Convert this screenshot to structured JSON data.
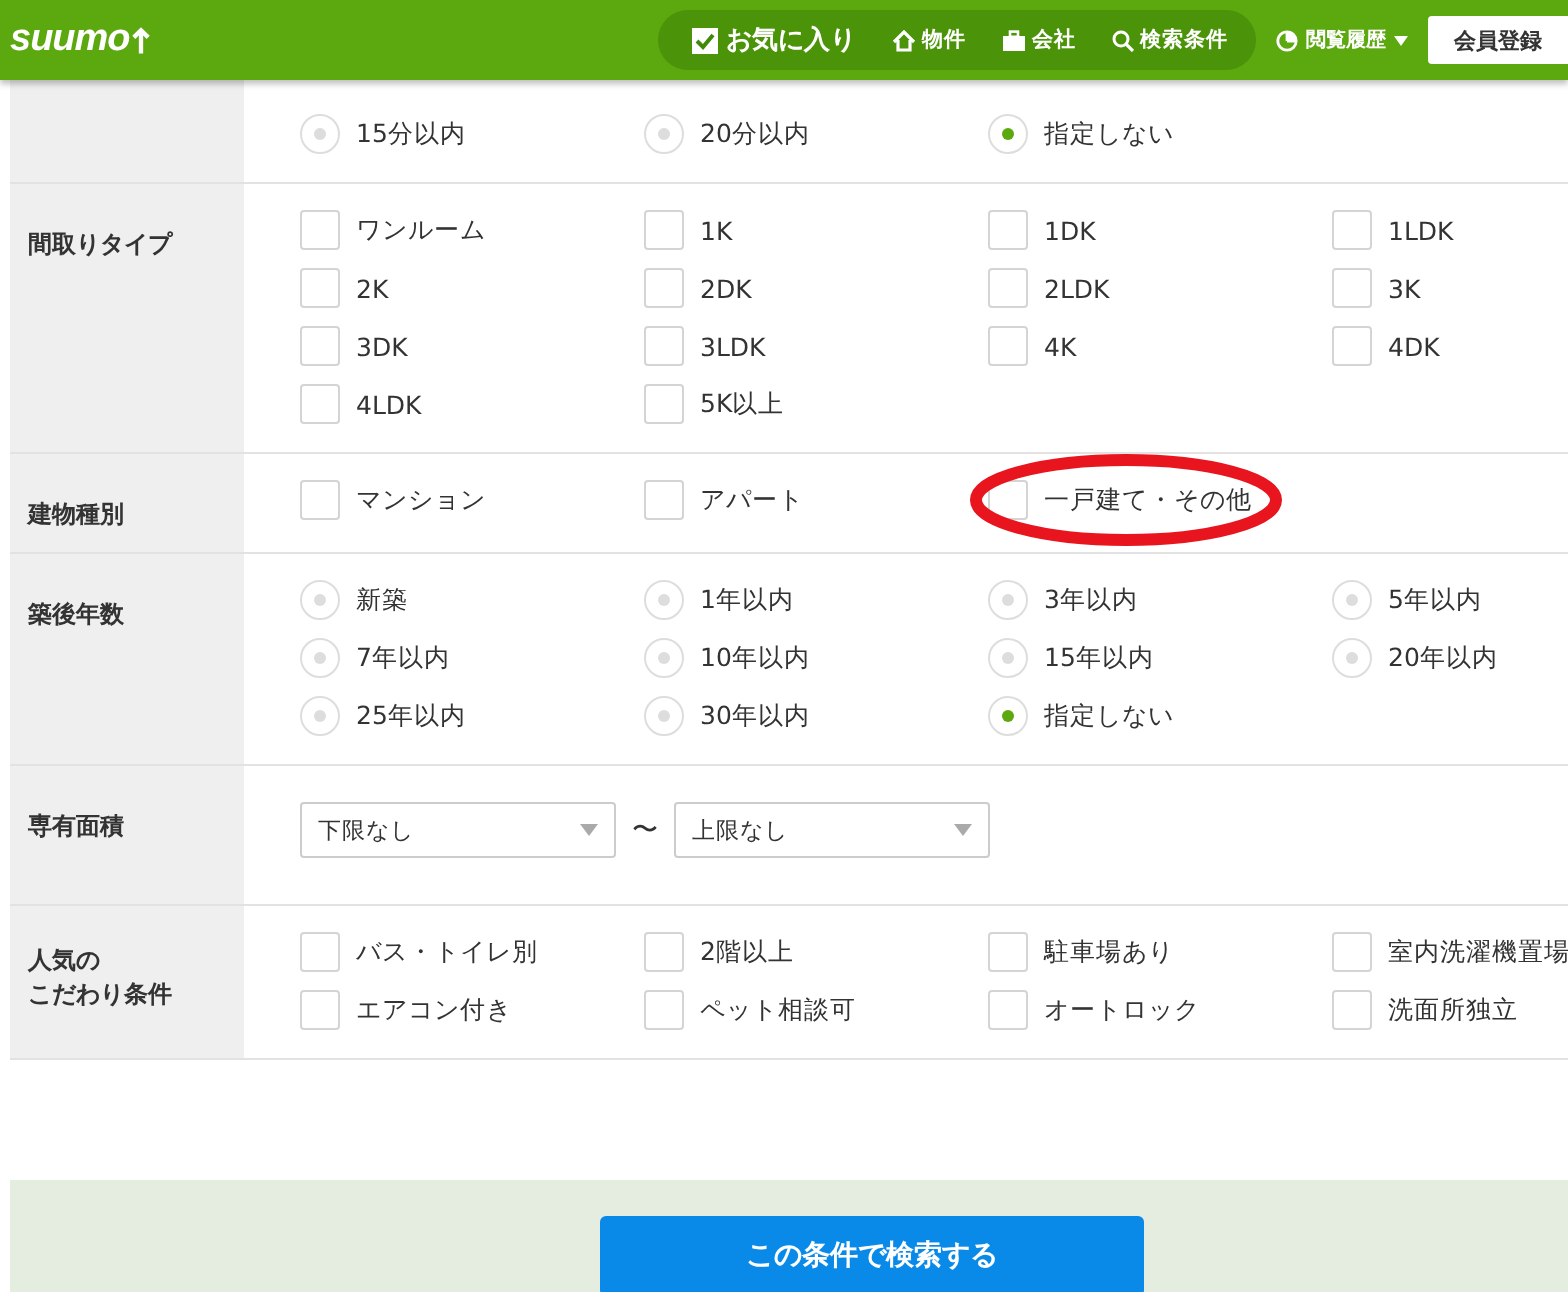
{
  "header": {
    "logo": "suumo",
    "nav": [
      {
        "kind": "favorite",
        "label": "お気に入り"
      },
      {
        "kind": "home",
        "label": "物件"
      },
      {
        "kind": "company",
        "label": "会社"
      },
      {
        "kind": "search",
        "label": "検索条件"
      }
    ],
    "history": "閲覧履歴",
    "register": "会員登録"
  },
  "sections": [
    {
      "kind": "radio",
      "options": [
        {
          "label": "15分以内",
          "selected": false
        },
        {
          "label": "20分以内",
          "selected": false
        },
        {
          "label": "指定しない",
          "selected": true
        }
      ]
    },
    {
      "label": "間取りタイプ",
      "kind": "checkbox",
      "options": [
        {
          "label": "ワンルーム",
          "checked": false
        },
        {
          "label": "1K",
          "checked": false
        },
        {
          "label": "1DK",
          "checked": false
        },
        {
          "label": "1LDK",
          "checked": false
        },
        {
          "label": "2K",
          "checked": false
        },
        {
          "label": "2DK",
          "checked": false
        },
        {
          "label": "2LDK",
          "checked": false
        },
        {
          "label": "3K",
          "checked": false
        },
        {
          "label": "3DK",
          "checked": false
        },
        {
          "label": "3LDK",
          "checked": false
        },
        {
          "label": "4K",
          "checked": false
        },
        {
          "label": "4DK",
          "checked": false
        },
        {
          "label": "4LDK",
          "checked": false
        },
        {
          "label": "5K以上",
          "checked": false
        }
      ]
    },
    {
      "label": "建物種別",
      "kind": "checkbox",
      "options": [
        {
          "label": "マンション",
          "checked": false
        },
        {
          "label": "アパート",
          "checked": false
        },
        {
          "label": "一戸建て・その他",
          "checked": false,
          "circled": true
        }
      ]
    },
    {
      "label": "築後年数",
      "kind": "radio",
      "options": [
        {
          "label": "新築",
          "selected": false
        },
        {
          "label": "1年以内",
          "selected": false
        },
        {
          "label": "3年以内",
          "selected": false
        },
        {
          "label": "5年以内",
          "selected": false
        },
        {
          "label": "7年以内",
          "selected": false
        },
        {
          "label": "10年以内",
          "selected": false
        },
        {
          "label": "15年以内",
          "selected": false
        },
        {
          "label": "20年以内",
          "selected": false
        },
        {
          "label": "25年以内",
          "selected": false
        },
        {
          "label": "30年以内",
          "selected": false
        },
        {
          "label": "指定しない",
          "selected": true
        }
      ]
    },
    {
      "label": "専有面積",
      "kind": "range",
      "min": "下限なし",
      "separator": "〜",
      "max": "上限なし"
    },
    {
      "label_lines": [
        "人気の",
        "こだわり条件"
      ],
      "kind": "checkbox",
      "options": [
        {
          "label": "バス・トイレ別",
          "checked": false
        },
        {
          "label": "2階以上",
          "checked": false
        },
        {
          "label": "駐車場あり",
          "checked": false
        },
        {
          "label": "室内洗濯機置場",
          "checked": false
        },
        {
          "label": "エアコン付き",
          "checked": false
        },
        {
          "label": "ペット相談可",
          "checked": false
        },
        {
          "label": "オートロック",
          "checked": false
        },
        {
          "label": "洗面所独立",
          "checked": false
        }
      ]
    }
  ],
  "search_button": "この条件で検索する"
}
